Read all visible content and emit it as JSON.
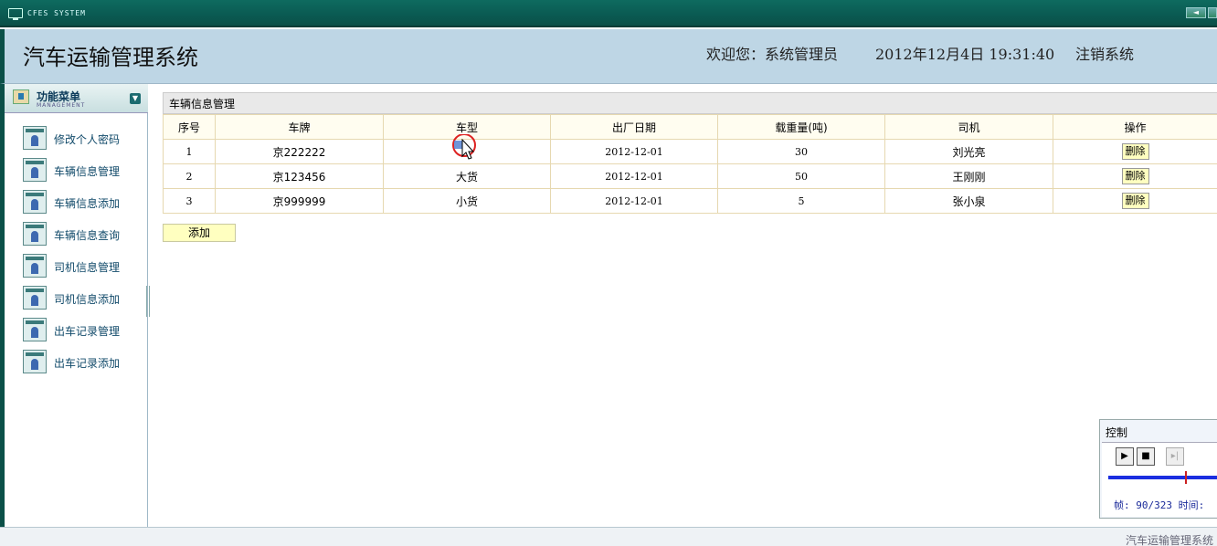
{
  "titlebar": {
    "app_code": "CFES SYSTEM"
  },
  "header": {
    "title": "汽车运输管理系统",
    "welcome": "欢迎您：系统管理员",
    "datetime": "2012年12月4日  19:31:40",
    "logout": "注销系统"
  },
  "menu": {
    "title": "功能菜单",
    "subtitle": "MANAGEMENT",
    "items": [
      {
        "label": "修改个人密码"
      },
      {
        "label": "车辆信息管理"
      },
      {
        "label": "车辆信息添加"
      },
      {
        "label": "车辆信息查询"
      },
      {
        "label": "司机信息管理"
      },
      {
        "label": "司机信息添加"
      },
      {
        "label": "出车记录管理"
      },
      {
        "label": "出车记录添加"
      }
    ]
  },
  "panel": {
    "title": "车辆信息管理",
    "columns": [
      "序号",
      "车牌",
      "车型",
      "出厂日期",
      "载重量(吨)",
      "司机",
      "操作"
    ],
    "rows": [
      {
        "no": "1",
        "plate": "京222222",
        "type": "",
        "date": "2012-12-01",
        "load": "30",
        "driver": "刘光亮",
        "action": "删除"
      },
      {
        "no": "2",
        "plate": "京123456",
        "type": "大货",
        "date": "2012-12-01",
        "load": "50",
        "driver": "王刚刚",
        "action": "删除"
      },
      {
        "no": "3",
        "plate": "京999999",
        "type": "小货",
        "date": "2012-12-01",
        "load": "5",
        "driver": "张小泉",
        "action": "删除"
      }
    ],
    "add_label": "添加"
  },
  "control": {
    "title": "控制",
    "frame_info": "帧: 90/323 时间:",
    "progress": 0.28
  },
  "status": {
    "text": "汽车运输管理系统"
  }
}
